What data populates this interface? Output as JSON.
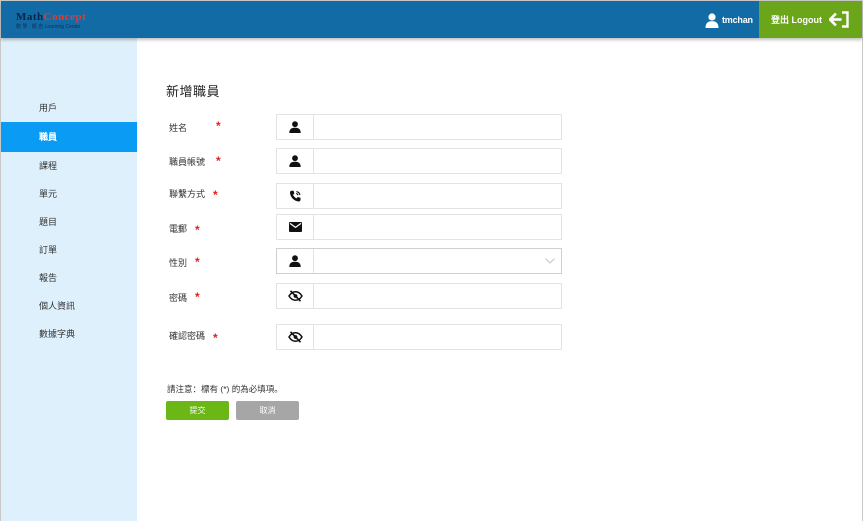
{
  "header": {
    "logo_main_1": "Math",
    "logo_main_2": "Concept",
    "logo_sub": "數 學 · 概 念 Learning Center",
    "username": "tmchan",
    "logout_label": "登出 Logout"
  },
  "sidebar": {
    "items": [
      {
        "label": "用戶",
        "active": false
      },
      {
        "label": "職員",
        "active": true
      },
      {
        "label": "課程",
        "active": false
      },
      {
        "label": "單元",
        "active": false
      },
      {
        "label": "題目",
        "active": false
      },
      {
        "label": "訂單",
        "active": false
      },
      {
        "label": "報告",
        "active": false
      },
      {
        "label": "個人資訊",
        "active": false
      },
      {
        "label": "數據字典",
        "active": false
      }
    ]
  },
  "form": {
    "title": "新增職員",
    "fields": [
      {
        "label": "姓名",
        "required_mark": "*",
        "icon": "user-icon",
        "value": ""
      },
      {
        "label": "職員帳號",
        "required_mark": "*",
        "icon": "user-icon",
        "value": ""
      },
      {
        "label": "聯繫方式",
        "required_mark": "*",
        "icon": "phone-icon",
        "value": ""
      },
      {
        "label": "電郵",
        "required_mark": "*",
        "icon": "mail-icon",
        "value": ""
      },
      {
        "label": "性別",
        "required_mark": "*",
        "icon": "user-icon",
        "value": ""
      },
      {
        "label": "密碼",
        "required_mark": "*",
        "icon": "eye-slash-icon",
        "value": ""
      },
      {
        "label": "確認密碼",
        "required_mark": "*",
        "icon": "eye-slash-icon",
        "value": ""
      }
    ],
    "note": "請注意：標有 (*) 的為必填項。",
    "submit_label": "提交",
    "cancel_label": "取消"
  },
  "colors": {
    "header_bg": "#136ba6",
    "logout_bg": "#6aa51a",
    "sidebar_bg": "#dff0fd",
    "active_item_bg": "#0a9bf4",
    "required_star": "#e62020",
    "submit_bg": "#6ab716",
    "cancel_bg": "#a6a6a6"
  }
}
